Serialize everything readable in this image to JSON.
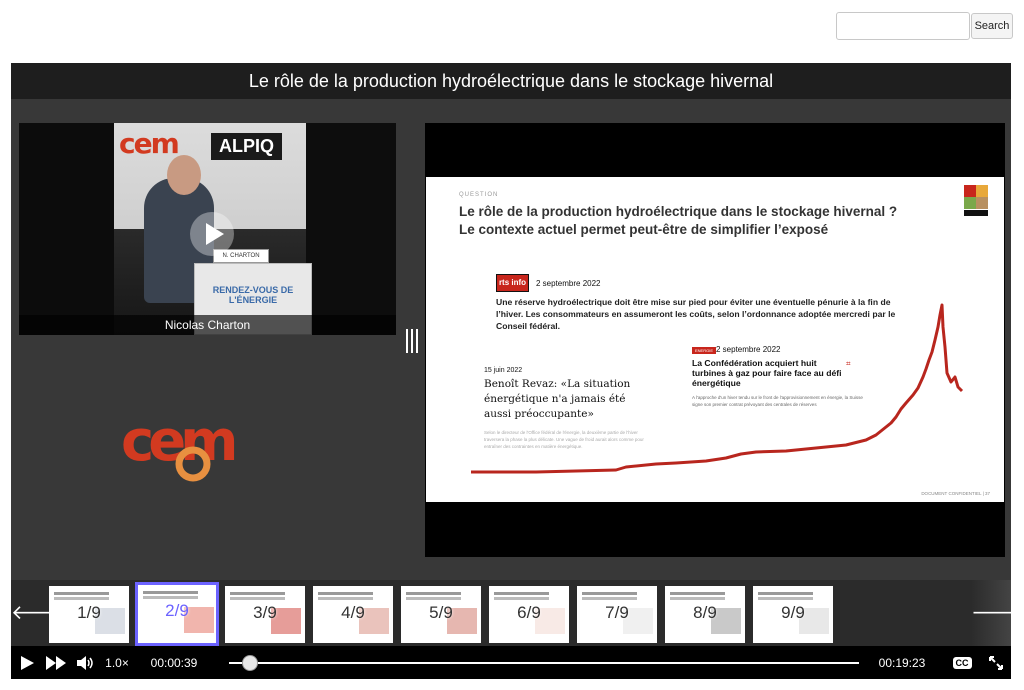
{
  "search": {
    "placeholder": "",
    "button_label": "Search"
  },
  "player": {
    "title": "Le rôle de la production hydroélectrique dans le stockage hivernal",
    "video": {
      "caption": "Nicolas Charton",
      "banner_logo": "cem",
      "banner_sponsor": "ALPIQ",
      "name_plate": "N. CHARTON",
      "podium_text": "RENDEZ-VOUS DE L'ÉNERGIE",
      "play_icon": "play-circle-icon"
    },
    "event_logo": "cem"
  },
  "slide": {
    "question_label": "QUESTION",
    "title_line1": "Le rôle de la production hydroélectrique dans le stockage hivernal ?",
    "title_line2": "Le contexte actuel permet peut-être de simplifier l’exposé",
    "news1": {
      "source": "rts info",
      "date": "2 septembre 2022",
      "text": "Une réserve hydroélectrique doit être mise sur pied pour éviter une éventuelle pénurie à la fin de l’hiver. Les consommateurs en assumeront les coûts, selon l’ordonnance adoptée mercredi par le Conseil fédéral."
    },
    "news2": {
      "date": "15 juin 2022",
      "title": "Benoît Revaz: «La situation énergétique n'a jamais été aussi préoccupante»",
      "body": "Selon le directeur de l'Office fédéral de l'énergie, la deuxième partie de l'hiver traversera la phase la plus délicate. Une vague de froid aurait alors comme pour entraîner des contraintes en matière énergétique."
    },
    "news3": {
      "tag": "ENERGIE",
      "date": "2 septembre 2022",
      "title": "La Confédération acquiert huit turbines à gaz pour faire face au défi énergétique",
      "body": "A l'approche d'un hiver tendu sur le front de l'approvisionnement en énergie, la Suisse signe son premier contrat prévoyant des centrales de réserves"
    },
    "footer": "DOCUMENT CONFIDENTIEL  |  37"
  },
  "thumbnails": [
    {
      "label": "1/9",
      "active": false
    },
    {
      "label": "2/9",
      "active": true
    },
    {
      "label": "3/9",
      "active": false
    },
    {
      "label": "4/9",
      "active": false
    },
    {
      "label": "5/9",
      "active": false
    },
    {
      "label": "6/9",
      "active": false
    },
    {
      "label": "7/9",
      "active": false
    },
    {
      "label": "8/9",
      "active": false
    },
    {
      "label": "9/9",
      "active": false
    }
  ],
  "controls": {
    "play_icon": "play-icon",
    "fast_forward_icon": "fast-forward-icon",
    "volume_icon": "volume-icon",
    "speed": "1.0×",
    "current_time": "00:00:39",
    "duration": "00:19:23",
    "progress_fraction": 0.034,
    "cc_label": "CC",
    "fullscreen_icon": "fullscreen-icon"
  },
  "colors": {
    "accent": "#6c63ff",
    "brand_red": "#c8261c",
    "player_bg": "#383838"
  }
}
